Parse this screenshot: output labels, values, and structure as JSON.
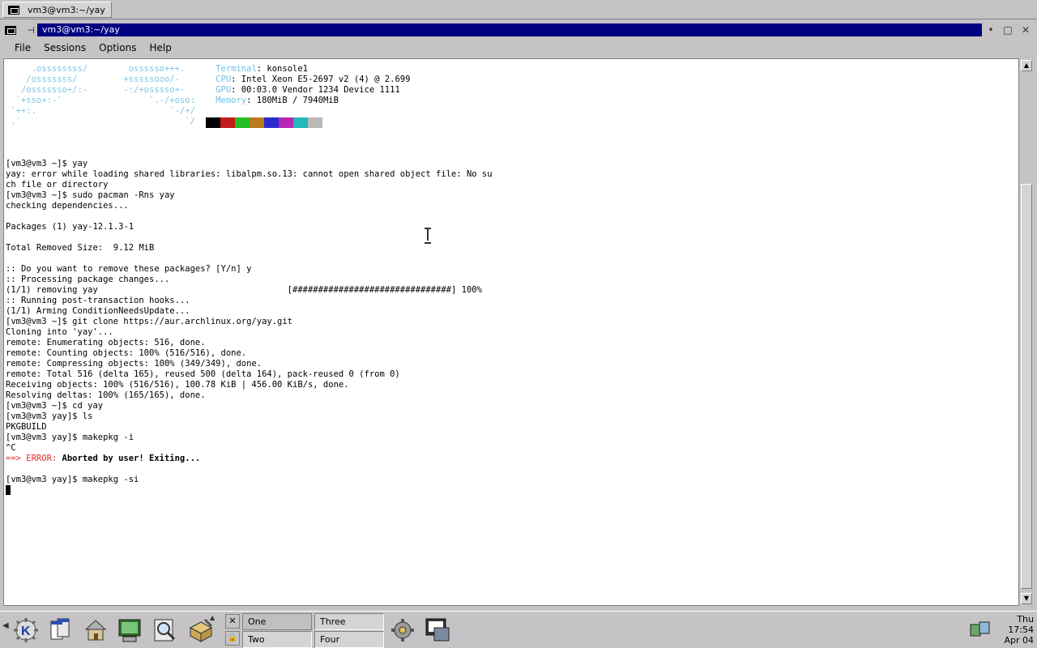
{
  "top_taskbar": {
    "task_title": "vm3@vm3:~/yay"
  },
  "window": {
    "title": "vm3@vm3:~/yay",
    "menu": [
      "File",
      "Sessions",
      "Options",
      "Help"
    ]
  },
  "terminal": {
    "neofetch": {
      "logo_lines": [
        "     .ossssssss/        ossssso+++.",
        "    /osssssss/         +sssssooo/-",
        "   /osssssso+/:-       -:/+osssso+-",
        "  `+sso+:-`                 `.-/+oso:",
        " `++:.                          `-/+/",
        " .`                                `/"
      ],
      "info": [
        {
          "label": "Terminal",
          "value": ": konsole1"
        },
        {
          "label": "CPU",
          "value": ": Intel Xeon E5-2697 v2 (4) @ 2.699"
        },
        {
          "label": "GPU",
          "value": ": 00:03.0 Vendor 1234 Device 1111"
        },
        {
          "label": "Memory",
          "value": ": 180MiB / 7940MiB"
        }
      ],
      "swatch_colors": [
        "#000000",
        "#c21b1b",
        "#25bc24",
        "#b87b1e",
        "#2a2acf",
        "#b526b5",
        "#24b7b7",
        "#b8b8b8"
      ]
    },
    "lines_before_error": [
      "[vm3@vm3 ~]$ yay",
      "yay: error while loading shared libraries: libalpm.so.13: cannot open shared object file: No su",
      "ch file or directory",
      "[vm3@vm3 ~]$ sudo pacman -Rns yay",
      "checking dependencies...",
      "",
      "Packages (1) yay-12.1.3-1",
      "",
      "Total Removed Size:  9.12 MiB",
      "",
      ":: Do you want to remove these packages? [Y/n] y",
      ":: Processing package changes...",
      "(1/1) removing yay                                     [###############################] 100%",
      ":: Running post-transaction hooks...",
      "(1/1) Arming ConditionNeedsUpdate...",
      "[vm3@vm3 ~]$ git clone https://aur.archlinux.org/yay.git",
      "Cloning into 'yay'...",
      "remote: Enumerating objects: 516, done.",
      "remote: Counting objects: 100% (516/516), done.",
      "remote: Compressing objects: 100% (349/349), done.",
      "remote: Total 516 (delta 165), reused 500 (delta 164), pack-reused 0 (from 0)",
      "Receiving objects: 100% (516/516), 100.78 KiB | 456.00 KiB/s, done.",
      "Resolving deltas: 100% (165/165), done.",
      "[vm3@vm3 ~]$ cd yay",
      "[vm3@vm3 yay]$ ls",
      "PKGBUILD",
      "[vm3@vm3 yay]$ makepkg -i",
      "^C"
    ],
    "error_prefix": "==> ERROR:",
    "error_message": " Aborted by user! Exiting...",
    "lines_after_error": [
      "",
      "[vm3@vm3 yay]$ makepkg -si"
    ]
  },
  "panel": {
    "desktops": [
      "One",
      "Two",
      "Three",
      "Four"
    ],
    "clock": {
      "day": "Thu",
      "time": "17:54",
      "date": "Apr 04"
    }
  }
}
